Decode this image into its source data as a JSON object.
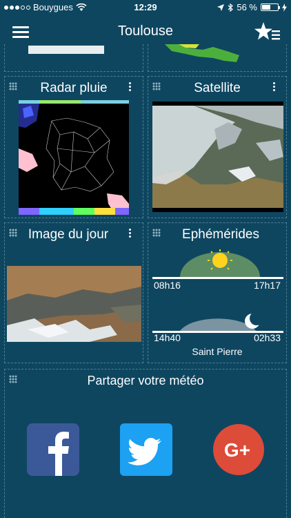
{
  "status_bar": {
    "carrier": "Bouygues",
    "time": "12:29",
    "battery": "56 %",
    "battery_level": 0.56
  },
  "nav": {
    "title": "Toulouse"
  },
  "cards": {
    "radar": {
      "title": "Radar pluie"
    },
    "satellite": {
      "title": "Satellite"
    },
    "image_du_jour": {
      "title": "Image du jour"
    },
    "ephemerides": {
      "title": "Ephémérides",
      "sunrise": "08h16",
      "sunset": "17h17",
      "moonrise": "14h40",
      "moonset": "02h33",
      "saint": "Saint Pierre"
    },
    "share": {
      "title": "Partager votre météo"
    }
  },
  "social": [
    {
      "name": "facebook",
      "color": "#3b5998"
    },
    {
      "name": "twitter",
      "color": "#1da1f2"
    },
    {
      "name": "google-plus",
      "color": "#dd4b39"
    }
  ],
  "colors": {
    "background": "#0e4660",
    "sun": "#ffd21f",
    "card_border": "#4f7f95"
  }
}
